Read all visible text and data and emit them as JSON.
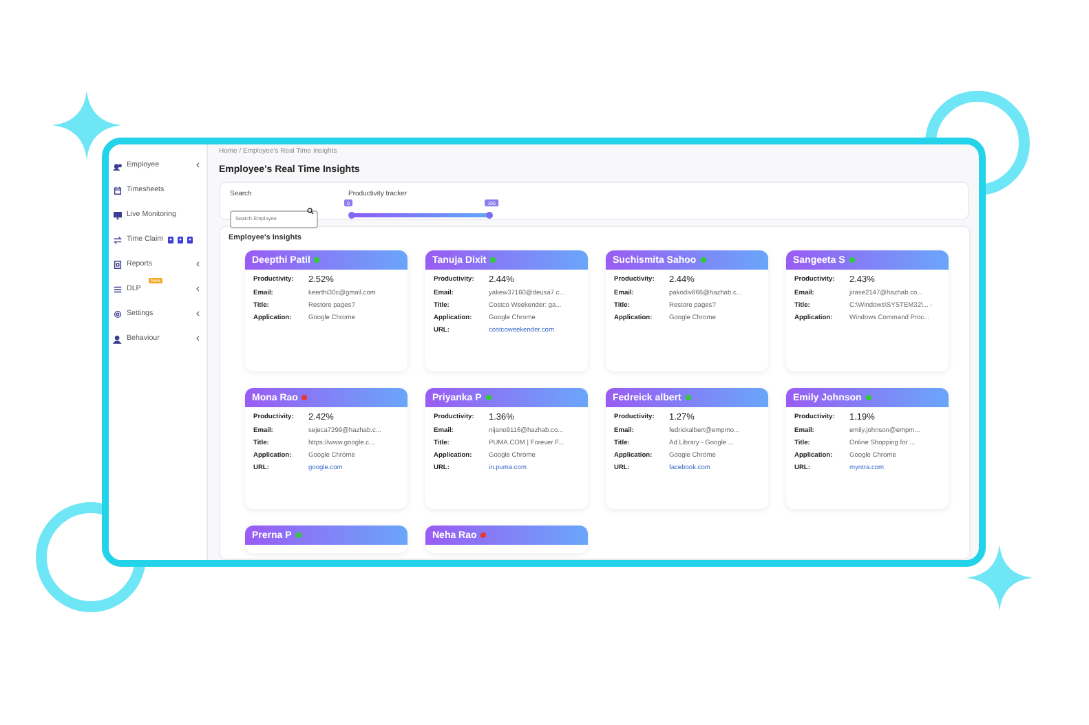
{
  "sidebar": {
    "items": [
      {
        "label": "Employee",
        "kind": "menu"
      },
      {
        "label": "Timesheets",
        "kind": "link"
      },
      {
        "label": "Live Monitoring",
        "kind": "link"
      },
      {
        "label": "Time Claim",
        "kind": "claim"
      },
      {
        "label": "Reports",
        "kind": "menu"
      },
      {
        "label": "DLP",
        "kind": "menu",
        "badge": "New"
      },
      {
        "label": "Settings",
        "kind": "menu"
      },
      {
        "label": "Behaviour",
        "kind": "menu"
      }
    ]
  },
  "breadcrumb": "Home /  Employee's Real Time Insights",
  "page_title": "Employee's Real Time Insights",
  "filters": {
    "search_label": "Search",
    "search_placeholder": "Search Employee",
    "tracker_label": "Productivity tracker",
    "range": {
      "low": {
        "label": "0",
        "level": 0
      },
      "high": {
        "label": "100",
        "level": 1
      }
    }
  },
  "insights": {
    "title": "Employee's Insights",
    "cards": [
      {
        "name": "Deepthi Patil",
        "color": "#2ecc2e",
        "fields": [
          {
            "label": "Productivity:",
            "value": "2.52%",
            "kind": "strong"
          },
          {
            "label": "Email:",
            "value": "keerthi30c@gmail.com",
            "kind": "text"
          },
          {
            "label": "Title:",
            "value": "Restore pages?",
            "kind": "text"
          },
          {
            "label": "Application:",
            "value": "Google Chrome",
            "kind": "text"
          }
        ]
      },
      {
        "name": "Tanuja Dixit",
        "color": "#2ecc2e",
        "fields": [
          {
            "label": "Productivity:",
            "value": "2.44%",
            "kind": "strong"
          },
          {
            "label": "Email:",
            "value": "yakew37160@deusa7.c...",
            "kind": "text"
          },
          {
            "label": "Title:",
            "value": "Costco Weekender: ga...",
            "kind": "text"
          },
          {
            "label": "Application:",
            "value": "Google Chrome",
            "kind": "text"
          },
          {
            "label": "URL:",
            "value": "costcoweekender.com",
            "kind": "link"
          }
        ]
      },
      {
        "name": "Suchismita Sahoo",
        "color": "#2ecc2e",
        "fields": [
          {
            "label": "Productivity:",
            "value": "2.44%",
            "kind": "strong"
          },
          {
            "label": "Email:",
            "value": "pakodiv866@hazhab.c...",
            "kind": "text"
          },
          {
            "label": "Title:",
            "value": "Restore pages?",
            "kind": "text"
          },
          {
            "label": "Application:",
            "value": "Google Chrome",
            "kind": "text"
          }
        ]
      },
      {
        "name": "Sangeeta S",
        "color": "#2ecc2e",
        "fields": [
          {
            "label": "Productivity:",
            "value": "2.43%",
            "kind": "strong"
          },
          {
            "label": "Email:",
            "value": "jirase2147@hazhab.co...",
            "kind": "text"
          },
          {
            "label": "Title:",
            "value": "C:\\Windows\\SYSTEM32\\... -",
            "kind": "text"
          },
          {
            "label": "Application:",
            "value": "Windows Command Proc...",
            "kind": "text"
          }
        ]
      },
      {
        "name": "Mona Rao",
        "color": "#e53935",
        "fields": [
          {
            "label": "Productivity:",
            "value": "2.42%",
            "kind": "strong"
          },
          {
            "label": "Email:",
            "value": "sejeca7299@hazhab.c...",
            "kind": "text"
          },
          {
            "label": "Title:",
            "value": "https://www.google.c...",
            "kind": "text"
          },
          {
            "label": "Application:",
            "value": "Google Chrome",
            "kind": "text"
          },
          {
            "label": "URL:",
            "value": "google.com",
            "kind": "link"
          }
        ]
      },
      {
        "name": "Priyanka P",
        "color": "#2ecc2e",
        "fields": [
          {
            "label": "Productivity:",
            "value": "1.36%",
            "kind": "strong"
          },
          {
            "label": "Email:",
            "value": "nijano9116@hazhab.co...",
            "kind": "text"
          },
          {
            "label": "Title:",
            "value": "PUMA.COM | Forever F...",
            "kind": "text"
          },
          {
            "label": "Application:",
            "value": "Google Chrome",
            "kind": "text"
          },
          {
            "label": "URL:",
            "value": "in.puma.com",
            "kind": "link"
          }
        ]
      },
      {
        "name": "Fedreick albert",
        "color": "#2ecc2e",
        "fields": [
          {
            "label": "Productivity:",
            "value": "1.27%",
            "kind": "strong"
          },
          {
            "label": "Email:",
            "value": "fedrickalbert@empmo...",
            "kind": "text"
          },
          {
            "label": "Title:",
            "value": "Ad Library - Google ...",
            "kind": "text"
          },
          {
            "label": "Application:",
            "value": "Google Chrome",
            "kind": "text"
          },
          {
            "label": "URL:",
            "value": "facebook.com",
            "kind": "link"
          }
        ]
      },
      {
        "name": "Emily Johnson",
        "color": "#2ecc2e",
        "fields": [
          {
            "label": "Productivity:",
            "value": "1.19%",
            "kind": "strong"
          },
          {
            "label": "Email:",
            "value": "emily.johnson@empm...",
            "kind": "text"
          },
          {
            "label": "Title:",
            "value": "Online Shopping for ...",
            "kind": "text"
          },
          {
            "label": "Application:",
            "value": "Google Chrome",
            "kind": "text"
          },
          {
            "label": "URL:",
            "value": "myntra.com",
            "kind": "link"
          }
        ]
      },
      {
        "name": "Prerna P",
        "color": "#2ecc2e"
      },
      {
        "name": "Neha Rao",
        "color": "#e53935"
      }
    ]
  }
}
